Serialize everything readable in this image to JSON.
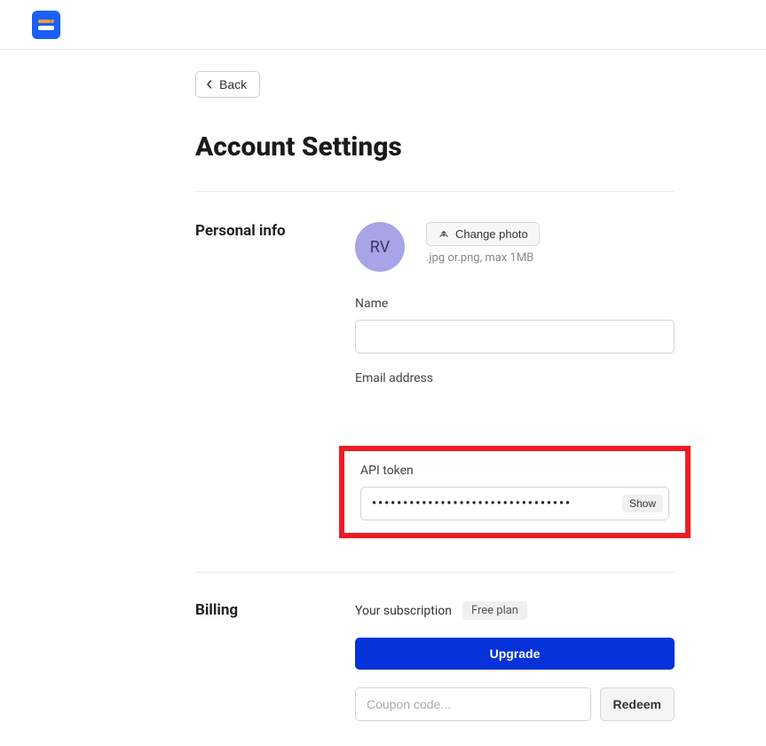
{
  "nav": {
    "back_label": "Back"
  },
  "page_title": "Account Settings",
  "personal": {
    "section_title": "Personal info",
    "avatar_initials": "RV",
    "change_photo_label": "Change photo",
    "photo_hint": ".jpg or.png, max 1MB",
    "name_label": "Name",
    "name_value": "",
    "email_label": "Email address",
    "email_value": "",
    "api_token_label": "API token",
    "api_token_mask": "••••••••••••••••••••••••••••••••",
    "show_label": "Show"
  },
  "billing": {
    "section_title": "Billing",
    "subscription_label": "Your subscription",
    "plan_name": "Free plan",
    "upgrade_label": "Upgrade",
    "coupon_placeholder": "Coupon code...",
    "redeem_label": "Redeem"
  }
}
